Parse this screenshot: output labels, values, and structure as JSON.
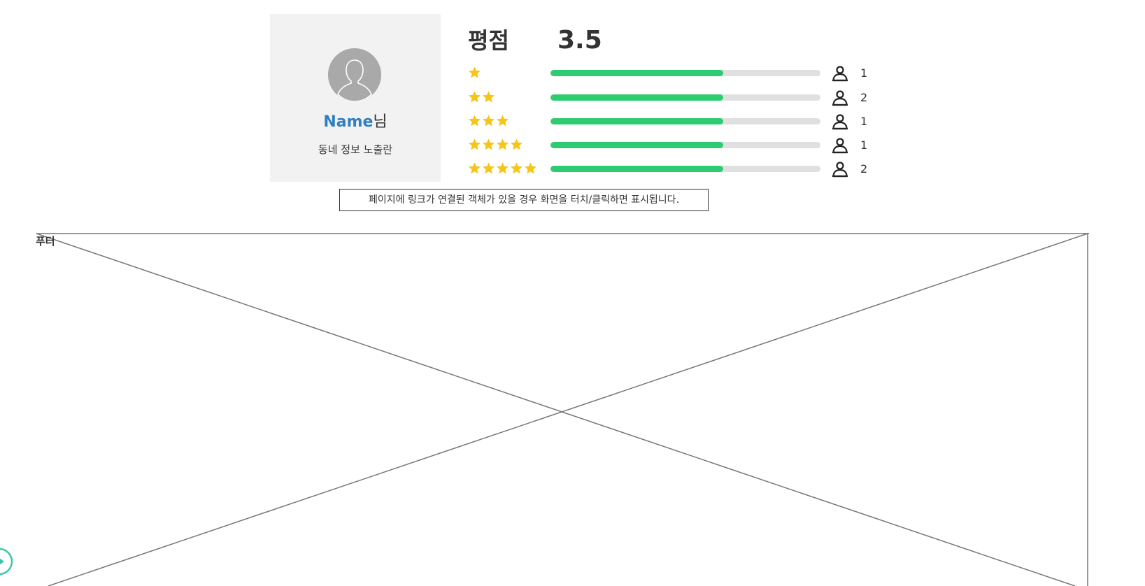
{
  "profile": {
    "name": "Name",
    "suffix": "님",
    "subtitle": "동네 정보 노출란",
    "avatar_icon": "user-silhouette-icon"
  },
  "rating": {
    "title": "평점",
    "score": "3.5",
    "rows": [
      {
        "stars": 1,
        "fill_fraction": 0.64,
        "count": "1"
      },
      {
        "stars": 2,
        "fill_fraction": 0.64,
        "count": "2"
      },
      {
        "stars": 3,
        "fill_fraction": 0.64,
        "count": "1"
      },
      {
        "stars": 4,
        "fill_fraction": 0.64,
        "count": "1"
      },
      {
        "stars": 5,
        "fill_fraction": 0.64,
        "count": "2"
      }
    ]
  },
  "notice": {
    "text": "페이지에 링크가 연결된 객체가 있을 경우 화면을 터치/클릭하면 표시됩니다."
  },
  "footer": {
    "label": "푸터"
  },
  "colors": {
    "name_accent": "#2f7fc1",
    "bar_fill": "#2ecc71",
    "bar_track": "#e0e0e0",
    "star": "#f5c518",
    "card_bg": "#f2f2f2",
    "nav_circle": "#3cc6a8"
  }
}
